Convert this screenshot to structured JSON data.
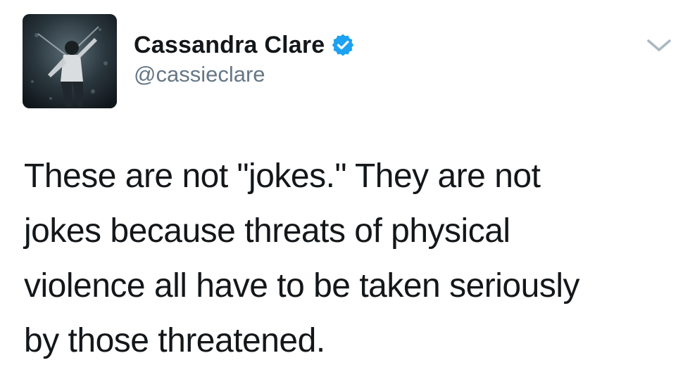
{
  "tweet": {
    "author": {
      "display_name": "Cassandra Clare",
      "handle": "@cassieclare",
      "verified": true,
      "avatar_icon": "profile-photo",
      "verified_icon": "verified-badge-icon",
      "verified_color": "#1da1f2"
    },
    "caret_icon": "chevron-down-icon",
    "text_lines": [
      "These are not \"jokes.\" They are not",
      "jokes because threats of physical",
      "violence all have to be taken seriously",
      "by those threatened."
    ]
  },
  "colors": {
    "text": "#14171a",
    "secondary": "#657786",
    "caret": "#aab8c2"
  }
}
